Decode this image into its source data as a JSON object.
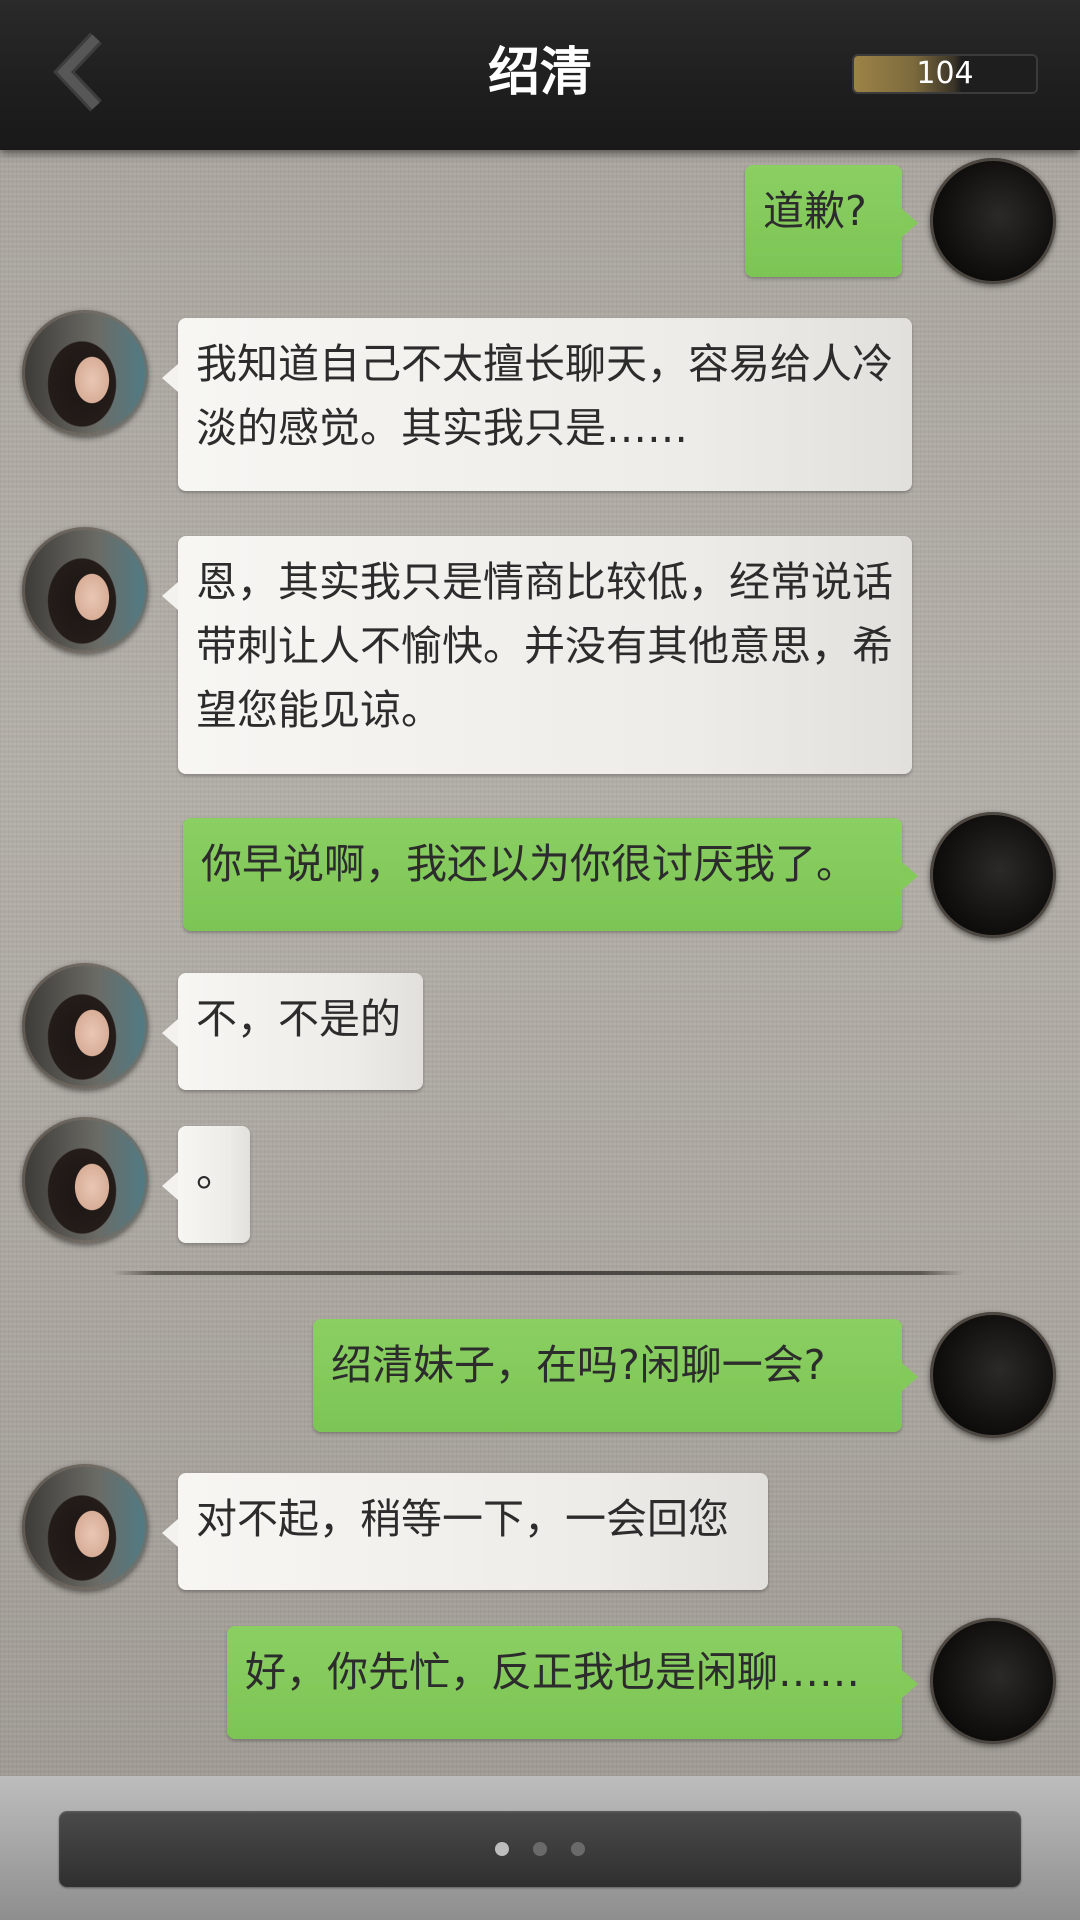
{
  "header": {
    "title": "绍清",
    "score": "104",
    "score_fill_fraction": 0.55
  },
  "messages": [
    {
      "sender": "me",
      "text": "道歉?"
    },
    {
      "sender": "her",
      "text": "我知道自己不太擅长聊天，容易给人冷淡的感觉。其实我只是……"
    },
    {
      "sender": "her",
      "text": "恩，其实我只是情商比较低，经常说话带刺让人不愉快。并没有其他意思，希望您能见谅。"
    },
    {
      "sender": "me",
      "text": "你早说啊，我还以为你很讨厌我了。"
    },
    {
      "sender": "her",
      "text": "不，不是的"
    },
    {
      "sender": "her",
      "text": "。"
    },
    {
      "sender": "me",
      "text": "绍清妹子，在吗?闲聊一会?"
    },
    {
      "sender": "her",
      "text": "对不起，稍等一下，一会回您"
    },
    {
      "sender": "me",
      "text": "好，你先忙，反正我也是闲聊……"
    }
  ],
  "icons": {
    "back": "chevron-left-icon",
    "her_avatar": "avatar-shaoqing",
    "my_avatar": "avatar-player"
  },
  "footer": {
    "dots": 3,
    "active_dot": 0
  },
  "colors": {
    "my_bubble": "#84ca5b",
    "her_bubble": "#f3f2ef",
    "header_bg": "#1e1e1e"
  }
}
